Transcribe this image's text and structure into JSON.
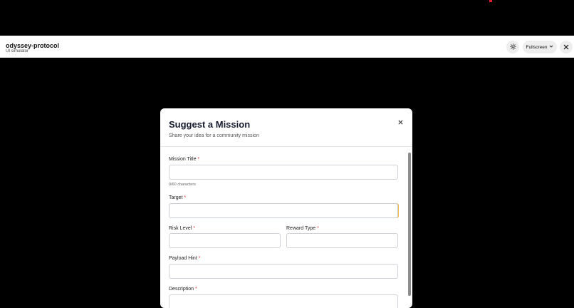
{
  "app": {
    "name": "odyssey-protocol",
    "subtitle": "UI simulator"
  },
  "toolbar": {
    "fullscreen_label": "Fullscreen",
    "theme_icon": "sun-icon",
    "close_icon": "close-icon"
  },
  "modal": {
    "title": "Suggest a Mission",
    "subtitle": "Share your idea for a community mission",
    "fields": {
      "mission_title": {
        "label": "Mission Title",
        "value": "",
        "counter": "0/60 characters"
      },
      "target": {
        "label": "Target",
        "value": ""
      },
      "risk_level": {
        "label": "Risk Level",
        "value": ""
      },
      "reward_type": {
        "label": "Reward Type",
        "value": ""
      },
      "payload_hint": {
        "label": "Payload Hint",
        "value": ""
      },
      "description": {
        "label": "Description",
        "value": ""
      }
    },
    "required_marker": "*"
  },
  "colors": {
    "required": "#e0303a",
    "title": "#161b2e",
    "background": "#000000"
  }
}
